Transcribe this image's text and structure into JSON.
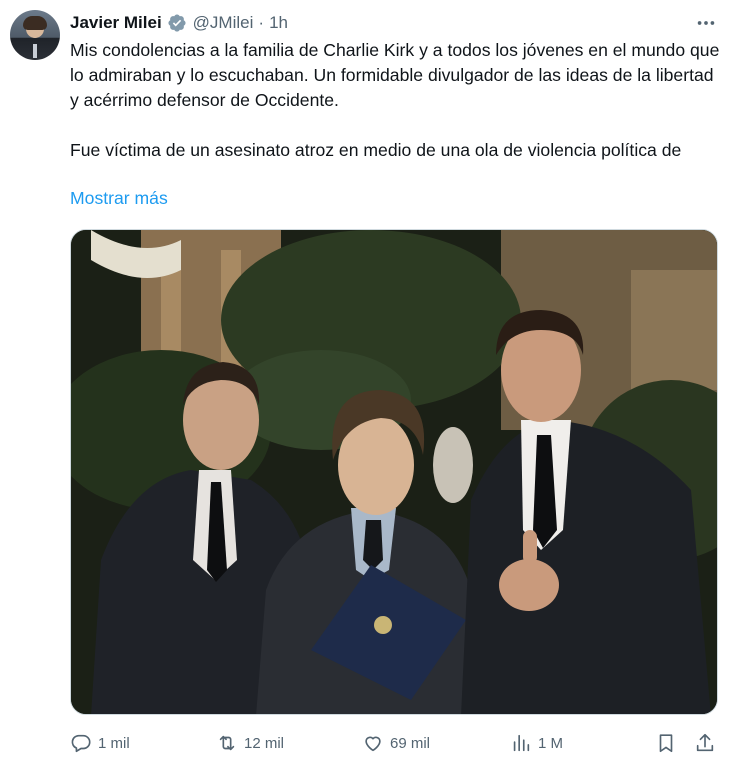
{
  "author": {
    "name": "Javier Milei",
    "handle": "@JMilei",
    "separator": "·",
    "time": "1h",
    "verified": true
  },
  "tweet": {
    "paragraph1": "Mis condolencias a la familia de Charlie Kirk y a todos los jóvenes en el mundo que lo admiraban y lo escuchaban. Un formidable divulgador de las ideas de la libertad y acérrimo defensor de Occidente.",
    "paragraph2": "Fue víctima de un asesinato atroz en medio de una ola de violencia política de",
    "show_more": "Mostrar más"
  },
  "actions": {
    "replies": "1 mil",
    "retweets": "12 mil",
    "likes": "69 mil",
    "views": "1 M"
  },
  "icons": {
    "verified": "verified-badge-icon",
    "more": "more-dots-icon",
    "reply": "reply-icon",
    "retweet": "retweet-icon",
    "like": "heart-icon",
    "views": "views-chart-icon",
    "bookmark": "bookmark-icon",
    "share": "share-icon"
  },
  "colors": {
    "text": "#0f1419",
    "secondary": "#536471",
    "link": "#1d9bf0",
    "border": "#cfd9de"
  }
}
